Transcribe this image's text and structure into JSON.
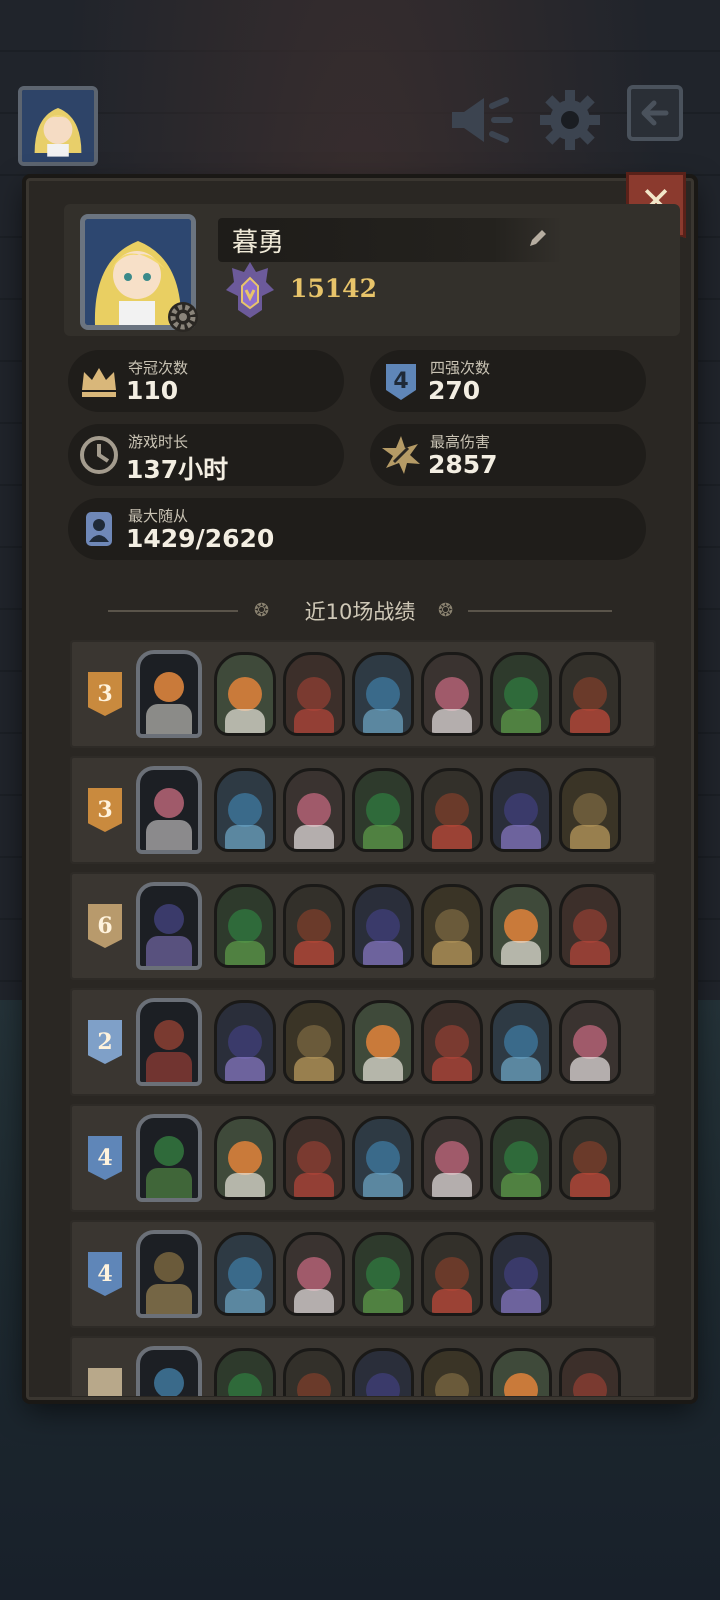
{
  "header": {
    "avatar_icon": "player-avatar-icon",
    "speaker_icon": "megaphone-icon",
    "settings_icon": "gear-icon",
    "exit_icon": "exit-arrow-icon"
  },
  "profile": {
    "name": "暮勇",
    "rank_score": "15142",
    "close_icon": "close-x-icon"
  },
  "stats": [
    {
      "label": "夺冠次数",
      "value": "110",
      "icon": "crown-icon"
    },
    {
      "label": "四强次数",
      "value": "270",
      "icon": "top4-shield-icon"
    },
    {
      "label": "游戏时长",
      "value": "137小时",
      "icon": "clock-icon"
    },
    {
      "label": "最高伤害",
      "value": "2857",
      "icon": "damage-burst-icon"
    },
    {
      "label": "最大随从",
      "value": "1429/2620",
      "icon": "minion-card-icon"
    }
  ],
  "recent": {
    "title": "近10场战绩",
    "matches": [
      {
        "place": "3",
        "units": 6
      },
      {
        "place": "3",
        "units": 6
      },
      {
        "place": "6",
        "units": 6
      },
      {
        "place": "2",
        "units": 6
      },
      {
        "place": "4",
        "units": 6
      },
      {
        "place": "4",
        "units": 5
      },
      {
        "place": "",
        "units": 6
      }
    ]
  },
  "colors": {
    "place_gold": "#c98a3e",
    "place_tan": "#b89a6c",
    "place_blue_light": "#7fa0c8",
    "place_blue": "#5f86b8",
    "accent_gold": "#e8c46a"
  }
}
